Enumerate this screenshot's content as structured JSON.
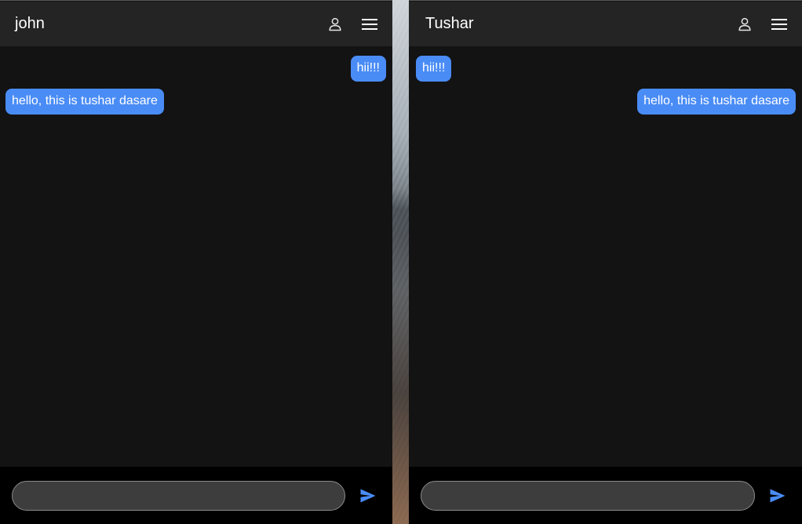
{
  "left_chat": {
    "title": "john",
    "composer": {
      "value": "",
      "placeholder": ""
    },
    "messages": [
      {
        "text": "hii!!!",
        "side": "me"
      },
      {
        "text": "hello, this is tushar dasare",
        "side": "them"
      }
    ]
  },
  "right_chat": {
    "title": "Tushar",
    "composer": {
      "value": "",
      "placeholder": ""
    },
    "messages": [
      {
        "text": "hii!!!",
        "side": "them"
      },
      {
        "text": "hello, this is tushar dasare",
        "side": "me"
      }
    ]
  },
  "icons": {
    "profile": "person-icon",
    "menu": "hamburger-menu-icon",
    "send": "send-icon"
  },
  "colors": {
    "bubble": "#4a8cf6",
    "header": "#242424",
    "chat_background": "#131313",
    "composer_bar": "#000000",
    "send_icon": "#4a8cf6"
  }
}
